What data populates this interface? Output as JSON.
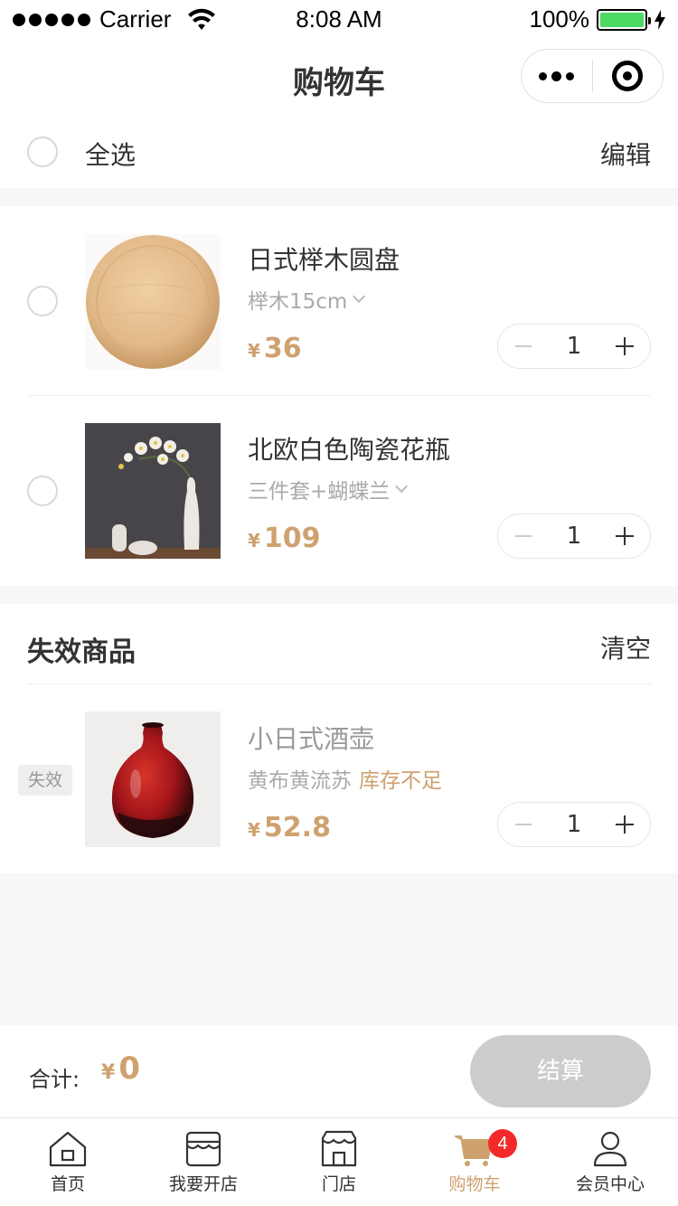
{
  "status_bar": {
    "carrier": "Carrier",
    "time": "8:08 AM",
    "battery": "100%"
  },
  "nav": {
    "title": "购物车"
  },
  "select_all": {
    "label": "全选",
    "edit": "编辑"
  },
  "cart_items": [
    {
      "name": "日式榉木圆盘",
      "spec": "榉木15cm",
      "currency": "¥",
      "price": "36",
      "quantity": "1"
    },
    {
      "name": "北欧白色陶瓷花瓶",
      "spec": "三件套+蝴蝶兰",
      "currency": "¥",
      "price": "109",
      "quantity": "1"
    }
  ],
  "invalid": {
    "title": "失效商品",
    "clear": "清空",
    "badge": "失效",
    "item": {
      "name": "小日式酒壶",
      "spec": "黄布黄流苏",
      "stock": "库存不足",
      "currency": "¥",
      "price": "52.8",
      "quantity": "1"
    }
  },
  "total": {
    "label": "合计:",
    "currency": "¥",
    "amount": "0",
    "checkout": "结算"
  },
  "tabs": [
    {
      "label": "首页",
      "icon": "home-icon"
    },
    {
      "label": "我要开店",
      "icon": "open-shop-icon"
    },
    {
      "label": "门店",
      "icon": "store-icon"
    },
    {
      "label": "购物车",
      "icon": "cart-icon",
      "badge": "4",
      "active": true
    },
    {
      "label": "会员中心",
      "icon": "member-icon"
    }
  ],
  "colors": {
    "accent": "#cfa16f",
    "badge": "#f42a2a",
    "checkout_disabled": "#cccccc",
    "battery": "#4cd964"
  }
}
